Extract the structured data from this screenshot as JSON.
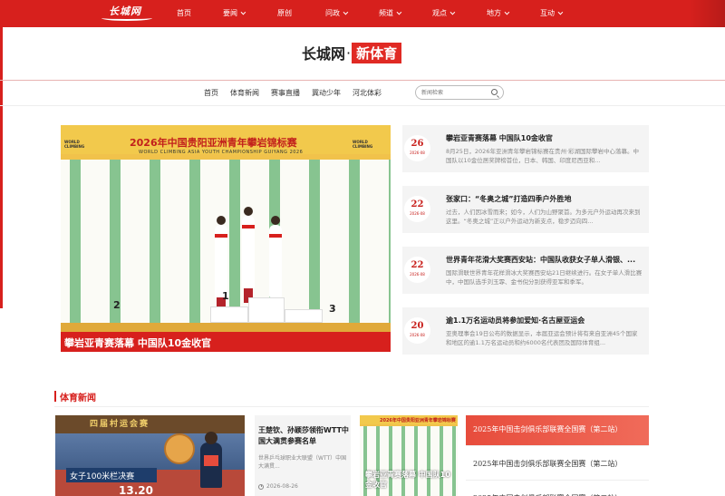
{
  "topnav": {
    "logo": "长城网",
    "items": [
      {
        "label": "首页",
        "dropdown": false
      },
      {
        "label": "要闻",
        "dropdown": true
      },
      {
        "label": "原创",
        "dropdown": false
      },
      {
        "label": "问政",
        "dropdown": true
      },
      {
        "label": "频道",
        "dropdown": true
      },
      {
        "label": "观点",
        "dropdown": true
      },
      {
        "label": "地方",
        "dropdown": true
      },
      {
        "label": "互动",
        "dropdown": true
      }
    ]
  },
  "brand": {
    "name": "长城网",
    "separator": "·",
    "channel": "新体育"
  },
  "subnav": {
    "items": [
      "首页",
      "体育新闻",
      "赛事直播",
      "冀动少年",
      "河北体彩"
    ],
    "search_placeholder": "新闻检索"
  },
  "hero": {
    "banner_title": "2026年中国贵阳亚洲青年攀岩锦标赛",
    "banner_sub": "WORLD CLIMBING ASIA YOUTH CHAMPIONSHIP GUIYANG 2026",
    "logo_text": "WORLD CLIMBING",
    "podium": [
      "2",
      "1",
      "3"
    ],
    "caption": "攀岩亚青赛落幕 中国队10金收官"
  },
  "news": [
    {
      "day": "26",
      "ym": "2026-08",
      "title": "攀岩亚青赛落幕 中国队10金收官",
      "desc": "8月25日，2026年亚洲青年攀岩锦标赛在贵州·彩湖国际攀岩中心落幕。中国队以10金位居奖牌榜首位，日本、韩国、印度尼西亚和..."
    },
    {
      "day": "22",
      "ym": "2026-08",
      "title": "张家口：“冬奥之城”打造四季户外胜地",
      "desc": "过去，人们因冰雪而来；如今，人们为山野聚首。为多元户外运动再次来到这里。“冬奥之城”正以户外运动为新支点，稳步迈向四..."
    },
    {
      "day": "22",
      "ym": "2026-08",
      "title": "世界青年花滑大奖赛西安站：中国队收获女子单人滑银、...",
      "desc": "国际滑联世界青年花样滑冰大奖赛西安站21日继续进行。在女子单人滑比赛中，中国队选手刘玉霏、金书倪分别获得亚军和季军。"
    },
    {
      "day": "20",
      "ym": "2026-08",
      "title": "逾1.1万名运动员将参加爱知·名古屋亚运会",
      "desc": "亚奥理事会19日公布的数据显示，本届亚运会预计将有来自亚洲45个国家和地区的逾1.1万名运动员和约6000名代表团及国际体育组..."
    }
  ],
  "section": {
    "title": "体育新闻"
  },
  "card1": {
    "sign": "四届村运会赛",
    "board": "女子100米栏决赛",
    "score": "13.20"
  },
  "card2": {
    "title": "王楚钦、孙颖莎领衔WTT中国大满贯参赛名单",
    "desc": "世界乒乓球职业大联盟（WTT）中国大满贯...",
    "time": "2026-08-26"
  },
  "card3": {
    "banner": "2026年中国贵阳亚洲青年攀岩锦标赛",
    "caption": "攀岩亚青赛落幕 中国队10金收官"
  },
  "tournaments": [
    {
      "label": "2025年中国击剑俱乐部联赛全国赛（第二站）",
      "active": true
    },
    {
      "label": "2025年中国击剑俱乐部联赛全国赛（第二站）",
      "active": false
    },
    {
      "label": "2025年中国击剑俱乐部联赛全国赛（第二站）",
      "active": false
    }
  ],
  "colors": {
    "brand_red": "#d7201d",
    "date_red": "#c8201c",
    "text_dark": "#222222",
    "text_gray": "#888888"
  }
}
